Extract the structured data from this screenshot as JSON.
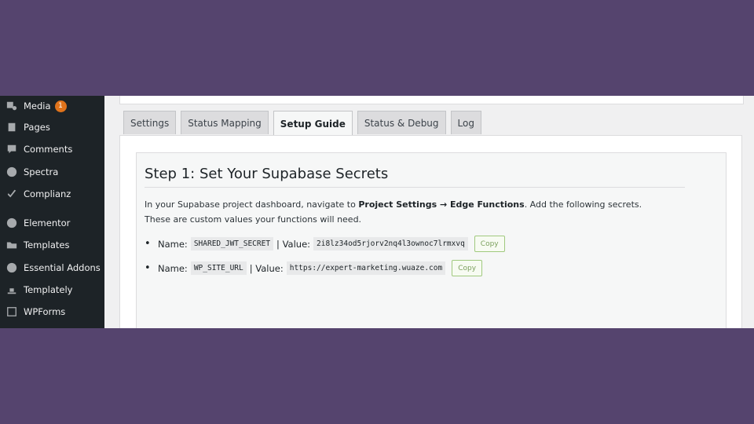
{
  "sidebar": {
    "items": [
      {
        "label": "Media",
        "icon": "media-icon",
        "badge": "1"
      },
      {
        "label": "Pages",
        "icon": "pages-icon"
      },
      {
        "label": "Comments",
        "icon": "comments-icon"
      },
      {
        "label": "Spectra",
        "icon": "spectra-icon"
      },
      {
        "label": "Complianz",
        "icon": "complianz-icon"
      },
      {
        "label": "Elementor",
        "icon": "elementor-icon"
      },
      {
        "label": "Templates",
        "icon": "templates-icon"
      },
      {
        "label": "Essential Addons",
        "icon": "essential-addons-icon"
      },
      {
        "label": "Templately",
        "icon": "templately-icon"
      },
      {
        "label": "WPForms",
        "icon": "wpforms-icon"
      }
    ]
  },
  "tabs": [
    {
      "label": "Settings"
    },
    {
      "label": "Status Mapping"
    },
    {
      "label": "Setup Guide",
      "active": true
    },
    {
      "label": "Status & Debug"
    },
    {
      "label": "Log"
    }
  ],
  "guide": {
    "title": "Step 1: Set Your Supabase Secrets",
    "desc_prefix": "In your Supabase project dashboard, navigate to ",
    "desc_bold": "Project Settings → Edge Functions",
    "desc_suffix": ". Add the following secrets.",
    "desc_line2": "These are custom values your functions will need.",
    "name_label": "Name:",
    "value_label": "| Value:",
    "bullet": "•",
    "copy_label": "Copy",
    "secrets": [
      {
        "name": "SHARED_JWT_SECRET",
        "value": "2i8lz34od5rjorv2nq4l3ownoc7lrmxvq"
      },
      {
        "name": "WP_SITE_URL",
        "value": "https://expert-marketing.wuaze.com"
      }
    ]
  },
  "colors": {
    "background": "#55446e",
    "sidebar": "#1d2327",
    "copy_border": "#a0c97e"
  }
}
